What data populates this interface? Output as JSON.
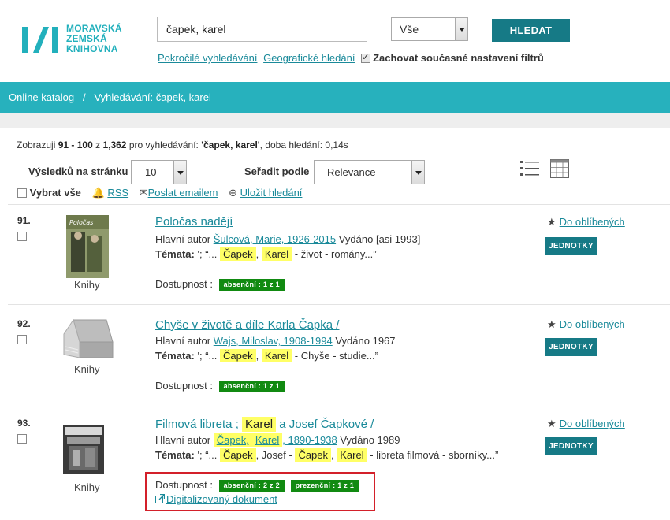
{
  "header": {
    "logo_lines": [
      "MORAVSKÁ",
      "ZEMSKÁ",
      "KNIHOVNA"
    ],
    "search_value": "čapek, karel",
    "scope_value": "Vše",
    "search_button": "HLEDAT",
    "advanced_link": "Pokročilé vyhledávání",
    "geo_link": "Geografické hledání",
    "keep_filters_label": "Zachovat současné nastavení filtrů",
    "keep_filters_checked": true
  },
  "breadcrumb": {
    "home": "Online katalog",
    "separator": "/",
    "current": "Vyhledávání: čapek, karel"
  },
  "summary": {
    "prefix": "Zobrazuji",
    "range": "91 - 100",
    "of_word": "z",
    "total": "1,362",
    "mid": "pro vyhledávání:",
    "query": "'čapek, karel'",
    "time": ", doba hledání: 0,14s"
  },
  "controls": {
    "per_page_label": "Výsledků na stránku",
    "per_page_value": "10",
    "sort_label": "Seřadit podle",
    "sort_value": "Relevance",
    "select_all": "Vybrat vše",
    "rss": "RSS",
    "email": "Poslat emailem",
    "save": "Uložit hledání",
    "view_list_icon": "list-view-icon",
    "view_grid_icon": "grid-view-icon"
  },
  "labels": {
    "author": "Hlavní autor",
    "published": "Vydáno",
    "topics": "Témata:",
    "availability": "Dostupnost :",
    "favorite": "Do oblíbených",
    "units": "JEDNOTKY"
  },
  "results": [
    {
      "num": "91.",
      "title": "Poločas nadějí",
      "format": "Knihy",
      "author": "Šulcová, Marie, 1926-2015",
      "year": "[asi 1993]",
      "topics": [
        "'; “...",
        "Čapek",
        ",",
        "Karel",
        "- život - romány...”"
      ],
      "availability": [
        "absenční : 1 z 1"
      ]
    },
    {
      "num": "92.",
      "title": "Chyše v životě a díle Karla Čapka /",
      "format": "Knihy",
      "author": "Wajs, Miloslav, 1908-1994",
      "year": "1967",
      "topics": [
        "'; “...",
        "Čapek",
        ",",
        "Karel",
        "- Chyše - studie...”"
      ],
      "availability": [
        "absenční : 1 z 1"
      ]
    },
    {
      "num": "93.",
      "title_parts": [
        "Filmová libreta ;",
        "Karel",
        "a Josef Čapkové /"
      ],
      "format": "Knihy",
      "author_parts": [
        "Čapek,",
        "Karel",
        ", 1890-1938"
      ],
      "year": "1989",
      "topics": [
        "'; “...",
        "Čapek",
        ", Josef -",
        "Čapek",
        ",",
        "Karel",
        "- libreta filmová - sborníky...”"
      ],
      "availability": [
        "absenční : 2 z 2",
        "prezenční : 1 z 1"
      ],
      "digital_link": "Digitalizovaný dokument"
    }
  ],
  "colors": {
    "band": "#27b1bd",
    "button": "#167a86",
    "highlight": "#ffff66",
    "badge": "#118a11",
    "annotation": "#d3202a"
  }
}
